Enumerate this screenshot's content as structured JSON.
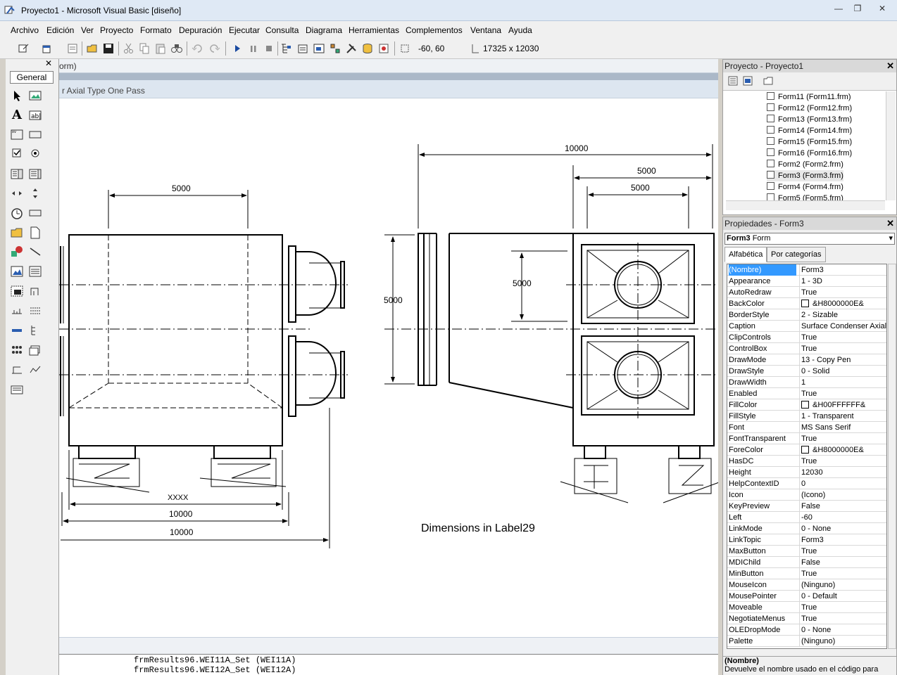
{
  "window": {
    "title": "Proyecto1 - Microsoft Visual Basic [diseño]"
  },
  "menu": [
    "Archivo",
    "Edición",
    "Ver",
    "Proyecto",
    "Formato",
    "Depuración",
    "Ejecutar",
    "Consulta",
    "Diagrama",
    "Herramientas",
    "Complementos",
    "Ventana",
    "Ayuda"
  ],
  "toolbar": {
    "position": "-60, 60",
    "size": "17325 x 12030"
  },
  "toolbox": {
    "tab": "General"
  },
  "designer": {
    "window_caption": "orm)",
    "form_caption": "r Axial Type One Pass",
    "dim_label": "Dimensions in Label29",
    "left_top_dim": "5000",
    "left_dim_xxxx": "XXXX",
    "left_dim_a": "10000",
    "left_dim_b": "10000",
    "right_top_dim": "10000",
    "right_dim_a": "5000",
    "right_dim_b": "5000",
    "right_vert_inner": "5000",
    "right_vert_outer": "5000"
  },
  "code": {
    "line1": "frmResults96.WEI11A_Set (WEI11A)",
    "line2": "frmResults96.WEI12A_Set (WEI12A)"
  },
  "project": {
    "title": "Proyecto - Proyecto1",
    "items": [
      "Form11 (Form11.frm)",
      "Form12 (Form12.frm)",
      "Form13 (Form13.frm)",
      "Form14 (Form14.frm)",
      "Form15 (Form15.frm)",
      "Form16 (Form16.frm)",
      "Form2 (Form2.frm)",
      "Form3 (Form3.frm)",
      "Form4 (Form4.frm)",
      "Form5 (Form5.frm)"
    ]
  },
  "properties": {
    "title": "Propiedades - Form3",
    "object_name": "Form3",
    "object_type": "Form",
    "tab_alpha": "Alfabética",
    "tab_cat": "Por categorías",
    "rows": [
      {
        "n": "(Nombre)",
        "v": "Form3"
      },
      {
        "n": "Appearance",
        "v": "1 - 3D"
      },
      {
        "n": "AutoRedraw",
        "v": "True"
      },
      {
        "n": "BackColor",
        "v": "&H8000000E&",
        "swatch": "#ffffff"
      },
      {
        "n": "BorderStyle",
        "v": "2 - Sizable"
      },
      {
        "n": "Caption",
        "v": "Surface Condenser Axial"
      },
      {
        "n": "ClipControls",
        "v": "True"
      },
      {
        "n": "ControlBox",
        "v": "True"
      },
      {
        "n": "DrawMode",
        "v": "13 - Copy Pen"
      },
      {
        "n": "DrawStyle",
        "v": "0 - Solid"
      },
      {
        "n": "DrawWidth",
        "v": "1"
      },
      {
        "n": "Enabled",
        "v": "True"
      },
      {
        "n": "FillColor",
        "v": "&H00FFFFFF&",
        "swatch": "#ffffff"
      },
      {
        "n": "FillStyle",
        "v": "1 - Transparent"
      },
      {
        "n": "Font",
        "v": "MS Sans Serif"
      },
      {
        "n": "FontTransparent",
        "v": "True"
      },
      {
        "n": "ForeColor",
        "v": "&H8000000E&",
        "swatch": "#ffffff"
      },
      {
        "n": "HasDC",
        "v": "True"
      },
      {
        "n": "Height",
        "v": "12030"
      },
      {
        "n": "HelpContextID",
        "v": "0"
      },
      {
        "n": "Icon",
        "v": "(Icono)"
      },
      {
        "n": "KeyPreview",
        "v": "False"
      },
      {
        "n": "Left",
        "v": "-60"
      },
      {
        "n": "LinkMode",
        "v": "0 - None"
      },
      {
        "n": "LinkTopic",
        "v": "Form3"
      },
      {
        "n": "MaxButton",
        "v": "True"
      },
      {
        "n": "MDIChild",
        "v": "False"
      },
      {
        "n": "MinButton",
        "v": "True"
      },
      {
        "n": "MouseIcon",
        "v": "(Ninguno)"
      },
      {
        "n": "MousePointer",
        "v": "0 - Default"
      },
      {
        "n": "Moveable",
        "v": "True"
      },
      {
        "n": "NegotiateMenus",
        "v": "True"
      },
      {
        "n": "OLEDropMode",
        "v": "0 - None"
      },
      {
        "n": "Palette",
        "v": "(Ninguno)"
      }
    ],
    "desc_title": "(Nombre)",
    "desc_text": "Devuelve el nombre usado en el código para"
  }
}
